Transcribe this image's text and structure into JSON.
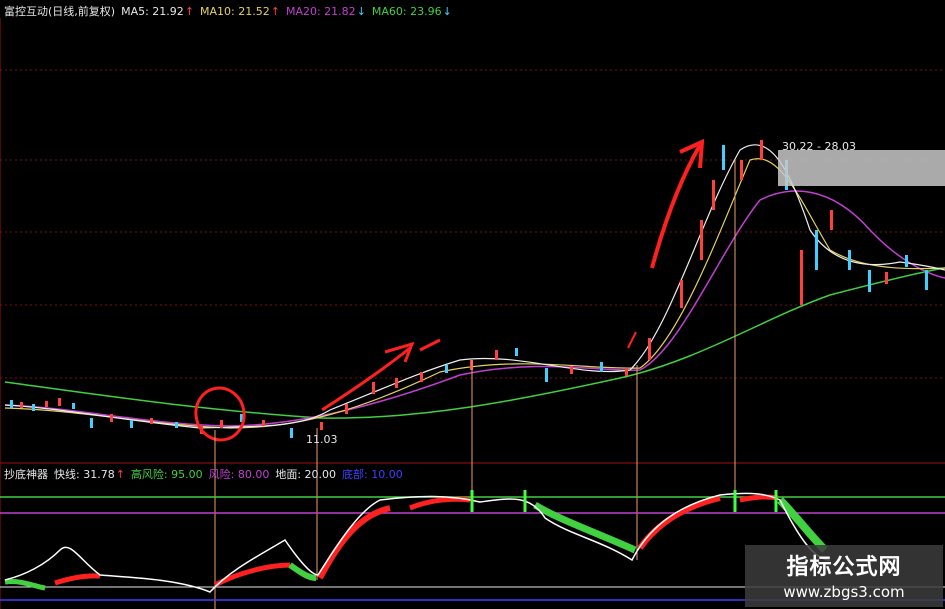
{
  "stock": {
    "title": "富控互动(日线,前复权)",
    "ma": [
      {
        "label": "MA5: 21.92",
        "arrow": "↑",
        "color": "#e6e6e6",
        "arrow_color": "#ff4040"
      },
      {
        "label": "MA10: 21.52",
        "arrow": "↑",
        "color": "#e6d25a",
        "arrow_color": "#ff4040"
      },
      {
        "label": "MA20: 21.82",
        "arrow": "↓",
        "color": "#c040d0",
        "arrow_color": "#40d0ff"
      },
      {
        "label": "MA60: 23.96",
        "arrow": "↓",
        "color": "#40d040",
        "arrow_color": "#40d0ff"
      }
    ],
    "high_range": "30.22 - 28.03",
    "low_mark": "11.03"
  },
  "indicator": {
    "name": "抄底神器",
    "fast": "快线: 31.78",
    "fast_arrow": "↑",
    "high_risk": "高风险: 95.00",
    "risk": "风险: 80.00",
    "ground": "地面: 20.00",
    "abyss": "底部: 10.00",
    "colors": {
      "high_risk": "#40d040",
      "risk": "#c040d0",
      "ground": "#e6e6e6",
      "abyss": "#4040ff"
    }
  },
  "watermark": {
    "title": "指标公式网",
    "url": "www.zbgs3.com"
  }
}
